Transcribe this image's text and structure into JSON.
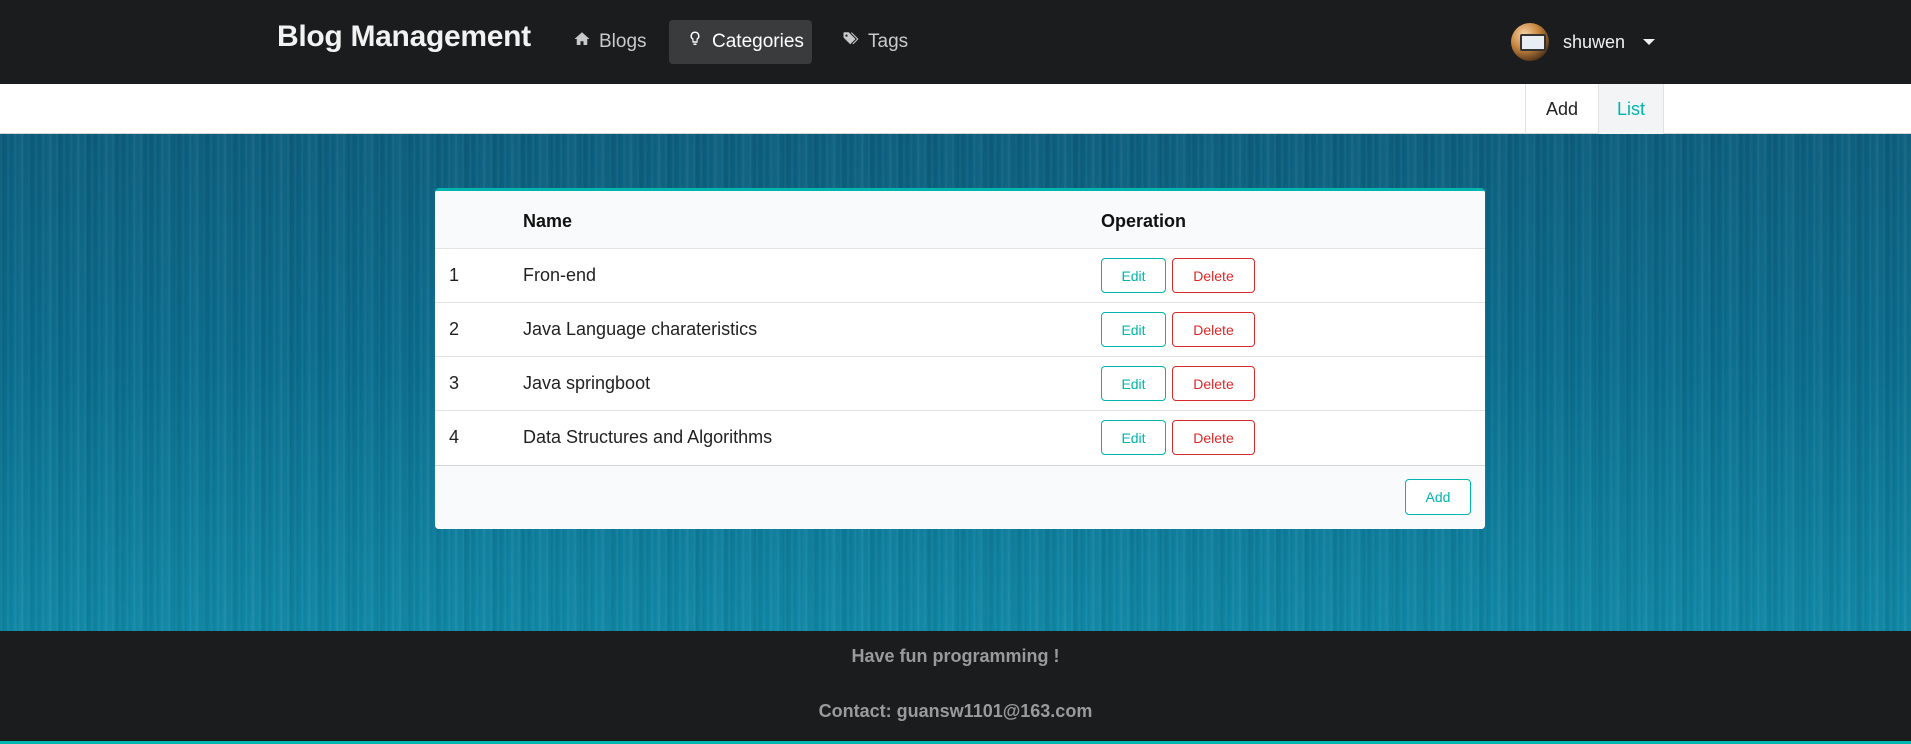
{
  "header": {
    "brand": "Blog Management",
    "nav": [
      {
        "label": "Blogs",
        "icon": "home-icon"
      },
      {
        "label": "Categories",
        "icon": "lightbulb-icon",
        "active": true
      },
      {
        "label": "Tags",
        "icon": "tags-icon"
      }
    ],
    "user": {
      "name": "shuwen"
    }
  },
  "submenu": {
    "add_label": "Add",
    "list_label": "List",
    "active": "List"
  },
  "table": {
    "columns": [
      "",
      "Name",
      "Operation"
    ],
    "rows": [
      {
        "index": "1",
        "name": "Fron-end",
        "edit": "Edit",
        "delete": "Delete"
      },
      {
        "index": "2",
        "name": "Java Language charateristics",
        "edit": "Edit",
        "delete": "Delete"
      },
      {
        "index": "3",
        "name": "Java springboot",
        "edit": "Edit",
        "delete": "Delete"
      },
      {
        "index": "4",
        "name": "Data Structures and Algorithms",
        "edit": "Edit",
        "delete": "Delete"
      }
    ],
    "footer_add_label": "Add"
  },
  "footer": {
    "tagline": "Have fun programming !",
    "contact": "Contact: guansw1101@163.com"
  },
  "colors": {
    "accent": "#00b5ad",
    "danger": "#db2828",
    "dark": "#1b1c1d"
  }
}
